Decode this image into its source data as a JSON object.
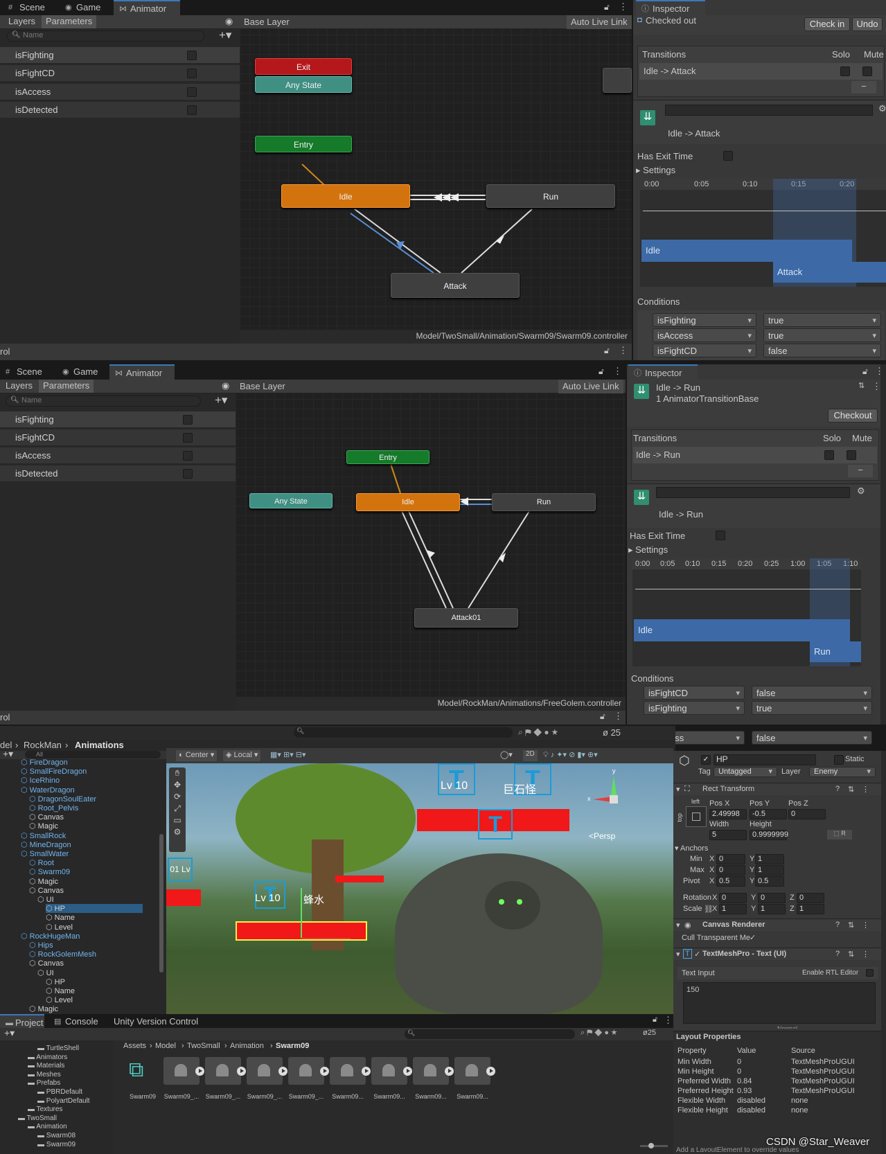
{
  "top": {
    "tabs": [
      "Scene",
      "Game",
      "Animator"
    ],
    "subtabs": [
      "Layers",
      "Parameters"
    ],
    "search_placeholder": "Name",
    "params": [
      "isFighting",
      "isFightCD",
      "isAccess",
      "isDetected"
    ],
    "breadcrumb": "Base Layer",
    "auto_live": "Auto Live Link",
    "nodes": {
      "exit": "Exit",
      "any": "Any State",
      "entry": "Entry",
      "idle": "Idle",
      "run": "Run",
      "attack": "Attack"
    },
    "path": "Model/TwoSmall/Animation/Swarm09/Swarm09.controller",
    "cut_label": "rol",
    "inspector": {
      "tab": "Inspector",
      "checked_out": "Checked out",
      "check_in": "Check in",
      "undo": "Undo",
      "transitions": "Transitions",
      "solo": "Solo",
      "mute": "Mute",
      "transition": "Idle -> Attack",
      "minus": "−",
      "preview_title": "Idle -> Attack",
      "has_exit": "Has Exit Time",
      "settings": "Settings",
      "ticks": [
        "0:00",
        "0:05",
        "0:10",
        "0:15",
        "0:20"
      ],
      "bar1": "Idle",
      "bar2": "Attack",
      "conditions": "Conditions",
      "cond": [
        [
          "isFighting",
          "true"
        ],
        [
          "isAccess",
          "true"
        ],
        [
          "isFightCD",
          "false"
        ]
      ]
    }
  },
  "mid": {
    "tabs": [
      "Scene",
      "Game",
      "Animator"
    ],
    "subtabs": [
      "Layers",
      "Parameters"
    ],
    "search_placeholder": "Name",
    "params": [
      "isFighting",
      "isFightCD",
      "isAccess",
      "isDetected"
    ],
    "breadcrumb": "Base Layer",
    "auto_live": "Auto Live Link",
    "nodes": {
      "any": "Any State",
      "entry": "Entry",
      "idle": "Idle",
      "run": "Run",
      "attack": "Attack01"
    },
    "path": "Model/RockMan/Animations/FreeGolem.controller",
    "cut_label": "rol",
    "inspector": {
      "tab": "Inspector",
      "title": "Idle -> Run",
      "subtitle": "1 AnimatorTransitionBase",
      "checkout": "Checkout",
      "transitions": "Transitions",
      "solo": "Solo",
      "mute": "Mute",
      "transition": "Idle -> Run",
      "minus": "−",
      "preview_title": "Idle -> Run",
      "has_exit": "Has Exit Time",
      "settings": "Settings",
      "ticks": [
        "0:00",
        "0:05",
        "0:10",
        "0:15",
        "0:20",
        "0:25",
        "1:00",
        "1:05",
        "1:10"
      ],
      "bar1": "Idle",
      "bar2": "Run",
      "conditions": "Conditions",
      "cond": [
        [
          "isFightCD",
          "false"
        ],
        [
          "isFighting",
          "true"
        ],
        [
          "isAccess",
          "false"
        ]
      ]
    }
  },
  "bottom": {
    "breadcrumb": [
      "del",
      "RockMan",
      "Animations"
    ],
    "count": "25",
    "search_all": "All",
    "scene_toolbar": {
      "center": "Center",
      "local": "Local",
      "mode2d": "2D"
    },
    "hierarchy": [
      {
        "t": "FireDragon",
        "d": 1,
        "c": "blue"
      },
      {
        "t": "SmallFireDragon",
        "d": 1,
        "c": "blue"
      },
      {
        "t": "IceRhino",
        "d": 1,
        "c": "blue"
      },
      {
        "t": "WaterDragon",
        "d": 1,
        "c": "blue"
      },
      {
        "t": "DragonSoulEater",
        "d": 2,
        "c": "blue"
      },
      {
        "t": "Root_Pelvis",
        "d": 2,
        "c": "blue"
      },
      {
        "t": "Canvas",
        "d": 2,
        "c": "white"
      },
      {
        "t": "Magic",
        "d": 2,
        "c": "white"
      },
      {
        "t": "SmallRock",
        "d": 1,
        "c": "blue"
      },
      {
        "t": "MineDragon",
        "d": 1,
        "c": "blue"
      },
      {
        "t": "SmallWater",
        "d": 1,
        "c": "blue"
      },
      {
        "t": "Root",
        "d": 2,
        "c": "blue"
      },
      {
        "t": "Swarm09",
        "d": 2,
        "c": "blue"
      },
      {
        "t": "Magic",
        "d": 2,
        "c": "white"
      },
      {
        "t": "Canvas",
        "d": 2,
        "c": "white"
      },
      {
        "t": "UI",
        "d": 3,
        "c": "white"
      },
      {
        "t": "HP",
        "d": 4,
        "c": "white"
      },
      {
        "t": "Name",
        "d": 4,
        "c": "white"
      },
      {
        "t": "Level",
        "d": 4,
        "c": "white"
      },
      {
        "t": "RockHugeMan",
        "d": 1,
        "c": "blue"
      },
      {
        "t": "Hips",
        "d": 2,
        "c": "blue"
      },
      {
        "t": "RockGolemMesh",
        "d": 2,
        "c": "blue"
      },
      {
        "t": "Canvas",
        "d": 2,
        "c": "white"
      },
      {
        "t": "UI",
        "d": 3,
        "c": "white"
      },
      {
        "t": "HP",
        "d": 4,
        "c": "white"
      },
      {
        "t": "Name",
        "d": 4,
        "c": "white"
      },
      {
        "t": "Level",
        "d": 4,
        "c": "white"
      },
      {
        "t": "Magic",
        "d": 2,
        "c": "white"
      }
    ],
    "scene_labels": {
      "lv_top": "Lv 10",
      "cn_top": "巨石怪",
      "lv_mid": "Lv 10",
      "cn_mid": "蜂水",
      "lv_left": "01 Lv",
      "persp": "<Persp",
      "axis_x": "x",
      "axis_y": "y"
    },
    "inspector": {
      "name": "HP",
      "static": "Static",
      "tag_label": "Tag",
      "tag": "Untagged",
      "layer_label": "Layer",
      "layer": "Enemy",
      "rect": "Rect Transform",
      "left": "left",
      "top": "top",
      "posx_l": "Pos X",
      "posy_l": "Pos Y",
      "posz_l": "Pos Z",
      "posx": "2.49998",
      "posy": "-0.5",
      "posz": "0",
      "width_l": "Width",
      "height_l": "Height",
      "width": "5",
      "height": "0.9999999",
      "anchors": "Anchors",
      "min": "Min",
      "max": "Max",
      "pivot": "Pivot",
      "rotation": "Rotation",
      "scale": "Scale",
      "x_l": "X",
      "y_l": "Y",
      "z_l": "Z",
      "min_x": "0",
      "min_y": "1",
      "max_x": "0",
      "max_y": "1",
      "pivot_x": "0.5",
      "pivot_y": "0.5",
      "rot_x": "0",
      "rot_y": "0",
      "rot_z": "0",
      "sc_x": "1",
      "sc_y": "1",
      "sc_z": "1",
      "canvas_renderer": "Canvas Renderer",
      "cull": "Cull Transparent Me",
      "tmp": "TextMeshPro - Text (UI)",
      "text_input": "Text Input",
      "rtl": "Enable RTL Editor",
      "text_value": "150",
      "dropdown_partial": "Normal",
      "layout_props": "Layout Properties",
      "lp_headers": [
        "Property",
        "Value",
        "Source"
      ],
      "lp_rows": [
        [
          "Min Width",
          "0",
          "TextMeshProUGUI"
        ],
        [
          "Min Height",
          "0",
          "TextMeshProUGUI"
        ],
        [
          "Preferred Width",
          "0.84",
          "TextMeshProUGUI"
        ],
        [
          "Preferred Height",
          "0.93",
          "TextMeshProUGUI"
        ],
        [
          "Flexible Width",
          "disabled",
          "none"
        ],
        [
          "Flexible Height",
          "disabled",
          "none"
        ]
      ],
      "add_layout": "Add a LayoutElement to override values"
    },
    "project": {
      "tabs": [
        "Project",
        "Console",
        "Unity Version Control"
      ],
      "tree": [
        {
          "t": "TurtleShell",
          "d": 3
        },
        {
          "t": "Animators",
          "d": 2
        },
        {
          "t": "Materials",
          "d": 2
        },
        {
          "t": "Meshes",
          "d": 2
        },
        {
          "t": "Prefabs",
          "d": 2
        },
        {
          "t": "PBRDefault",
          "d": 3
        },
        {
          "t": "PolyartDefault",
          "d": 3
        },
        {
          "t": "Textures",
          "d": 2
        },
        {
          "t": "TwoSmall",
          "d": 1
        },
        {
          "t": "Animation",
          "d": 2
        },
        {
          "t": "Swarm08",
          "d": 3
        },
        {
          "t": "Swarm09",
          "d": 3
        }
      ],
      "path": [
        "Assets",
        "Model",
        "TwoSmall",
        "Animation",
        "Swarm09"
      ],
      "count": "25",
      "assets": [
        "Swarm09",
        "Swarm09_...",
        "Swarm09_...",
        "Swarm09_...",
        "Swarm09_...",
        "Swarm09...",
        "Swarm09...",
        "Swarm09...",
        "Swarm09..."
      ]
    },
    "watermark": "CSDN @Star_Weaver"
  }
}
